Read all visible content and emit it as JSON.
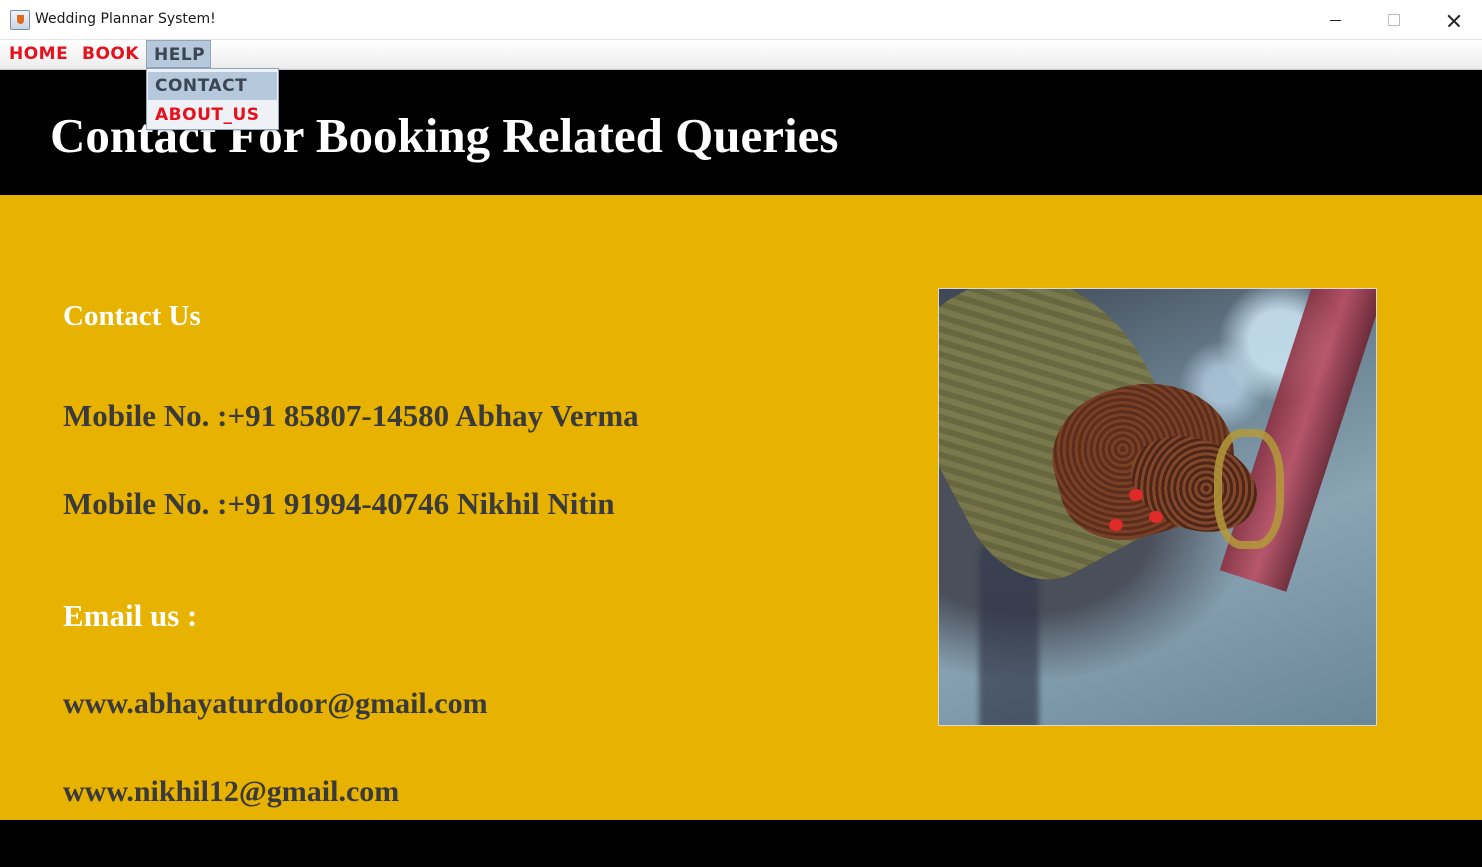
{
  "window": {
    "title": "Wedding Plannar System!"
  },
  "menubar": {
    "items": [
      {
        "label": "HOME"
      },
      {
        "label": "BOOK"
      },
      {
        "label": "HELP"
      }
    ]
  },
  "help_menu": {
    "items": [
      {
        "label": "CONTACT"
      },
      {
        "label": "ABOUT_US"
      }
    ]
  },
  "header": {
    "title": "Contact For Booking Related Queries"
  },
  "contact": {
    "heading": "Contact Us",
    "mobiles": [
      "Mobile No. :+91 85807-14580  Abhay Verma",
      "Mobile No. :+91 91994-40746  Nikhil Nitin"
    ],
    "email_heading": "Email us :",
    "emails": [
      "www.abhayaturdoor@gmail.com",
      "www.nikhil12@gmail.com"
    ]
  },
  "colors": {
    "menu_text": "#e8101a",
    "menu_selected_bg": "#b6c9dc",
    "header_bg": "#000000",
    "panel_bg": "#e8b200",
    "heading_text": "#ffffff",
    "body_text": "#3a3a3a"
  },
  "icons": {
    "app": "java-app-icon",
    "photo": "wedding-hands-photo"
  }
}
